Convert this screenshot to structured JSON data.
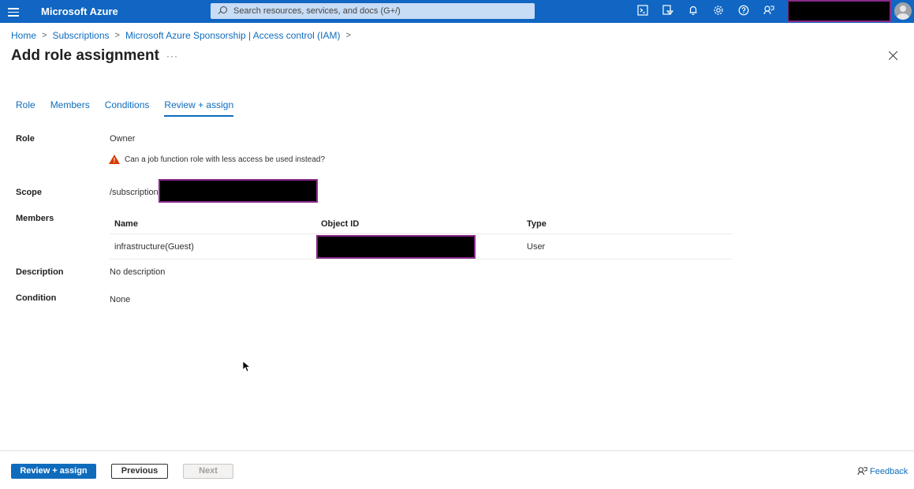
{
  "topbar": {
    "brand": "Microsoft Azure",
    "search_placeholder": "Search resources, services, and docs (G+/)",
    "icons": [
      "cloud-shell-icon",
      "directory-filter-icon",
      "notifications-icon",
      "settings-icon",
      "help-icon",
      "feedback-icon"
    ]
  },
  "breadcrumb": {
    "items": [
      "Home",
      "Subscriptions",
      "Microsoft Azure Sponsorship | Access control (IAM)"
    ]
  },
  "page": {
    "title": "Add role assignment",
    "more": "···"
  },
  "tabs": {
    "items": [
      "Role",
      "Members",
      "Conditions",
      "Review + assign"
    ],
    "active": "Review + assign"
  },
  "details": {
    "role_label": "Role",
    "role_value": "Owner",
    "warning": "Can a job function role with less access be used instead?",
    "scope_label": "Scope",
    "scope_value": "/subscriptions",
    "members_label": "Members",
    "members_table": {
      "columns": [
        "Name",
        "Object ID",
        "Type"
      ],
      "rows": [
        {
          "name": "infrastructure(Guest)",
          "object_id": "",
          "type": "User"
        }
      ]
    },
    "description_label": "Description",
    "description_value": "No description",
    "condition_label": "Condition",
    "condition_value": "None"
  },
  "footer": {
    "primary": "Review + assign",
    "previous": "Previous",
    "next": "Next",
    "feedback": "Feedback"
  },
  "colors": {
    "topbar": "#1066c2",
    "link": "#0f6cbd",
    "warning": "#d83b01",
    "redaction_border": "#8a2a8a"
  }
}
